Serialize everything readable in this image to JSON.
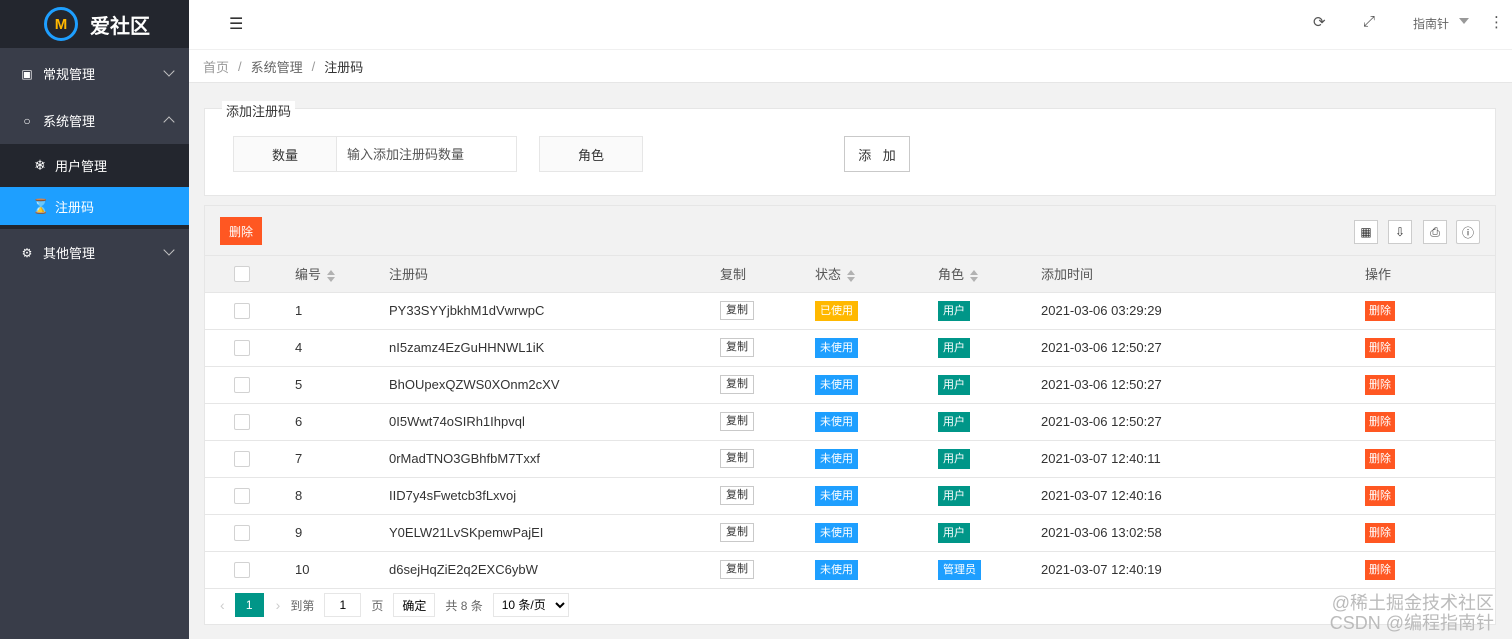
{
  "app": {
    "logo_text": "爱社区",
    "logo_mark": "M"
  },
  "sidebar": {
    "items": [
      {
        "label": "常规管理",
        "icon": "id-card-icon",
        "expanded": false
      },
      {
        "label": "系统管理",
        "icon": "circle-icon",
        "expanded": true,
        "children": [
          {
            "label": "用户管理",
            "icon": "snowflake-icon",
            "active": false
          },
          {
            "label": "注册码",
            "icon": "hourglass-icon",
            "active": true
          }
        ]
      },
      {
        "label": "其他管理",
        "icon": "gear-icon",
        "expanded": false
      }
    ]
  },
  "header": {
    "user_name": "指南针"
  },
  "breadcrumb": [
    "首页",
    "系统管理",
    "注册码"
  ],
  "form": {
    "legend": "添加注册码",
    "quantity_label": "数量",
    "quantity_placeholder": "输入添加注册码数量",
    "role_label": "角色",
    "add_button": "添 加"
  },
  "table": {
    "delete_button": "删除",
    "columns": [
      "编号",
      "注册码",
      "复制",
      "状态",
      "角色",
      "添加时间",
      "操作"
    ],
    "copy_label": "复制",
    "delete_label": "删除",
    "rows": [
      {
        "id": "1",
        "code": "PY33SYYjbkhM1dVwrwpC",
        "status": "已使用",
        "status_type": "used",
        "role": "用户",
        "role_type": "user",
        "time": "2021-03-06 03:29:29"
      },
      {
        "id": "4",
        "code": "nI5zamz4EzGuHHNWL1iK",
        "status": "未使用",
        "status_type": "unused",
        "role": "用户",
        "role_type": "user",
        "time": "2021-03-06 12:50:27"
      },
      {
        "id": "5",
        "code": "BhOUpexQZWS0XOnm2cXV",
        "status": "未使用",
        "status_type": "unused",
        "role": "用户",
        "role_type": "user",
        "time": "2021-03-06 12:50:27"
      },
      {
        "id": "6",
        "code": "0I5Wwt74oSIRh1Ihpvql",
        "status": "未使用",
        "status_type": "unused",
        "role": "用户",
        "role_type": "user",
        "time": "2021-03-06 12:50:27"
      },
      {
        "id": "7",
        "code": "0rMadTNO3GBhfbM7Txxf",
        "status": "未使用",
        "status_type": "unused",
        "role": "用户",
        "role_type": "user",
        "time": "2021-03-07 12:40:11"
      },
      {
        "id": "8",
        "code": "IID7y4sFwetcb3fLxvoj",
        "status": "未使用",
        "status_type": "unused",
        "role": "用户",
        "role_type": "user",
        "time": "2021-03-07 12:40:16"
      },
      {
        "id": "9",
        "code": "Y0ELW21LvSKpemwPajEI",
        "status": "未使用",
        "status_type": "unused",
        "role": "用户",
        "role_type": "user",
        "time": "2021-03-06 13:02:58"
      },
      {
        "id": "10",
        "code": "d6sejHqZiE2q2EXC6ybW",
        "status": "未使用",
        "status_type": "unused",
        "role": "管理员",
        "role_type": "admin",
        "time": "2021-03-07 12:40:19"
      }
    ]
  },
  "pager": {
    "current_page": "1",
    "goto_prefix": "到第",
    "goto_value": "1",
    "goto_suffix": "页",
    "confirm_label": "确定",
    "total_text": "共 8 条",
    "page_size": "10 条/页"
  },
  "watermark": {
    "line1": "@稀土掘金技术社区",
    "line2": "CSDN @编程指南针"
  },
  "colors": {
    "sidebar_bg": "#393d49",
    "active_blue": "#1e9fff",
    "danger": "#ff5722",
    "warn": "#ffb800",
    "teal": "#009688"
  }
}
